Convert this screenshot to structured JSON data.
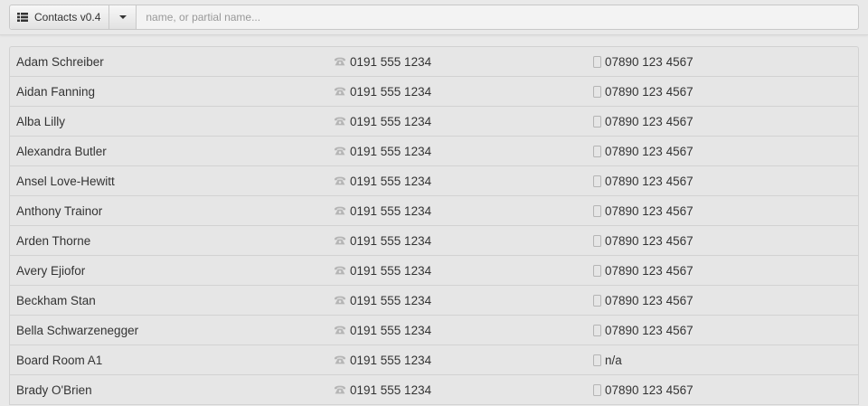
{
  "toolbar": {
    "app_label": "Contacts v0.4",
    "app_icon": "list-icon",
    "dropdown_icon": "caret-down-icon",
    "search_placeholder": "name, or partial name..."
  },
  "columns": {
    "phone_icon": "phone-icon",
    "mobile_icon": "mobile-icon"
  },
  "contacts": [
    {
      "name": "Adam Schreiber",
      "phone": "0191 555 1234",
      "mobile": "07890 123 4567"
    },
    {
      "name": "Aidan Fanning",
      "phone": "0191 555 1234",
      "mobile": "07890 123 4567"
    },
    {
      "name": "Alba Lilly",
      "phone": "0191 555 1234",
      "mobile": "07890 123 4567"
    },
    {
      "name": "Alexandra Butler",
      "phone": "0191 555 1234",
      "mobile": "07890 123 4567"
    },
    {
      "name": "Ansel Love-Hewitt",
      "phone": "0191 555 1234",
      "mobile": "07890 123 4567"
    },
    {
      "name": "Anthony Trainor",
      "phone": "0191 555 1234",
      "mobile": "07890 123 4567"
    },
    {
      "name": "Arden Thorne",
      "phone": "0191 555 1234",
      "mobile": "07890 123 4567"
    },
    {
      "name": "Avery Ejiofor",
      "phone": "0191 555 1234",
      "mobile": "07890 123 4567"
    },
    {
      "name": "Beckham Stan",
      "phone": "0191 555 1234",
      "mobile": "07890 123 4567"
    },
    {
      "name": "Bella Schwarzenegger",
      "phone": "0191 555 1234",
      "mobile": "07890 123 4567"
    },
    {
      "name": "Board Room A1",
      "phone": "0191 555 1234",
      "mobile": "n/a"
    },
    {
      "name": "Brady O'Brien",
      "phone": "0191 555 1234",
      "mobile": "07890 123 4567"
    }
  ],
  "colors": {
    "background": "#e9e9e9",
    "text": "#333333",
    "icon": "#b5b5b5",
    "border": "#d2d2d2"
  }
}
